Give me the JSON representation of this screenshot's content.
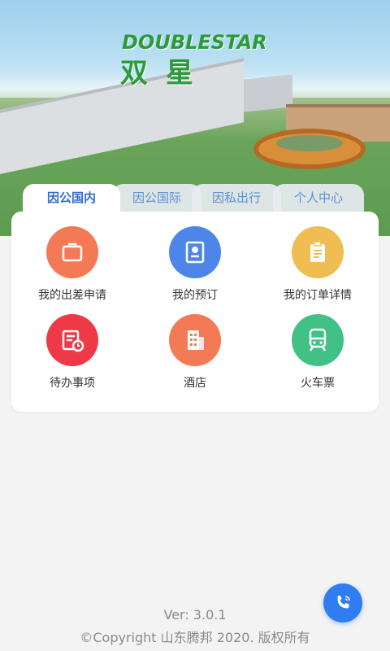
{
  "brand": {
    "name_en": "DOUBLESTAR",
    "name_cn": "双星"
  },
  "tabs": [
    "因公国内",
    "因公国际",
    "因私出行",
    "个人中心"
  ],
  "menu": [
    {
      "label": "我的出差申请",
      "icon": "briefcase-icon",
      "color": "#f47a55"
    },
    {
      "label": "我的预订",
      "icon": "reservation-icon",
      "color": "#4d86e8"
    },
    {
      "label": "我的订单详情",
      "icon": "clipboard-icon",
      "color": "#f0bd52"
    },
    {
      "label": "待办事项",
      "icon": "todo-icon",
      "color": "#ee3a47"
    },
    {
      "label": "酒店",
      "icon": "hotel-icon",
      "color": "#f47a55"
    },
    {
      "label": "火车票",
      "icon": "train-icon",
      "color": "#42c187"
    }
  ],
  "footer": {
    "version": "Ver: 3.0.1",
    "copyright": "©Copyright 山东腾邦 2020. 版权所有"
  },
  "colors": {
    "accent": "#2f6fd6",
    "background": "#f3f3f4"
  }
}
